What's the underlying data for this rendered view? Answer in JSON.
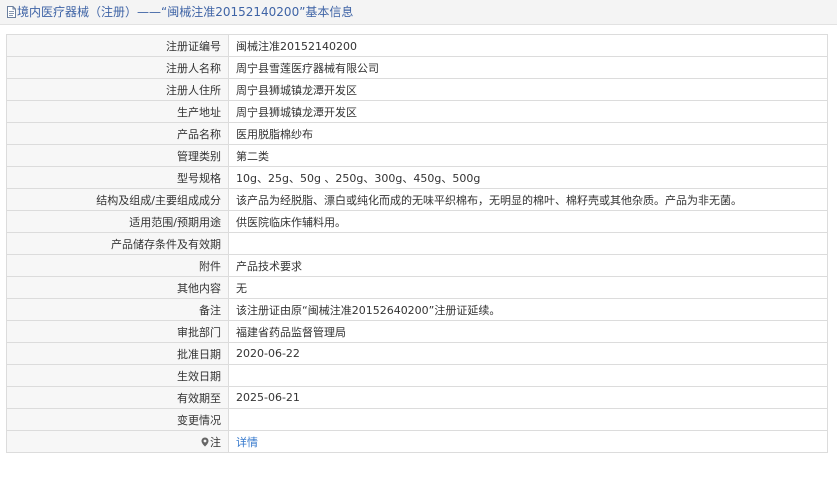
{
  "header": {
    "title": "境内医疗器械（注册）——“闽械注准20152140200”基本信息",
    "icon": "document-icon"
  },
  "rows": [
    {
      "label": "注册证编号",
      "value": "闽械注准20152140200"
    },
    {
      "label": "注册人名称",
      "value": "周宁县雪莲医疗器械有限公司"
    },
    {
      "label": "注册人住所",
      "value": "周宁县狮城镇龙潭开发区"
    },
    {
      "label": "生产地址",
      "value": "周宁县狮城镇龙潭开发区"
    },
    {
      "label": "产品名称",
      "value": "医用脱脂棉纱布"
    },
    {
      "label": "管理类别",
      "value": "第二类"
    },
    {
      "label": "型号规格",
      "value": "10g、25g、50g 、250g、300g、450g、500g"
    },
    {
      "label": "结构及组成/主要组成成分",
      "value": "该产品为经脱脂、漂白或纯化而成的无味平织棉布，无明显的棉叶、棉籽壳或其他杂质。产品为非无菌。"
    },
    {
      "label": "适用范围/预期用途",
      "value": "供医院临床作辅料用。"
    },
    {
      "label": "产品储存条件及有效期",
      "value": ""
    },
    {
      "label": "附件",
      "value": "产品技术要求"
    },
    {
      "label": "其他内容",
      "value": "无"
    },
    {
      "label": "备注",
      "value": "该注册证由原“闽械注准20152640200”注册证延续。"
    },
    {
      "label": "审批部门",
      "value": "福建省药品监督管理局"
    },
    {
      "label": "批准日期",
      "value": "2020-06-22"
    },
    {
      "label": "生效日期",
      "value": ""
    },
    {
      "label": "有效期至",
      "value": "2025-06-21"
    },
    {
      "label": "变更情况",
      "value": ""
    }
  ],
  "note_row": {
    "label": "注",
    "link": "详情",
    "icon": "note-icon"
  },
  "colors": {
    "title": "#3f64a6",
    "link": "#3377cc",
    "label_bg": "#f7f7f7",
    "border": "#dcdcdc"
  }
}
